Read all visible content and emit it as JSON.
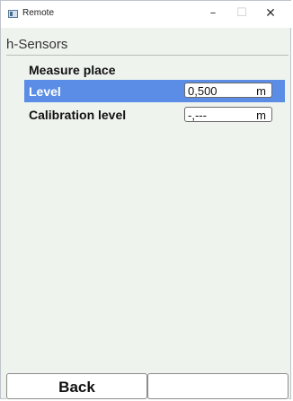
{
  "window": {
    "title": "Remote",
    "icon": "app-icon",
    "controls": {
      "minimize": "–",
      "maximize": "☐",
      "close": "✕"
    }
  },
  "screen": {
    "section_title": "h-Sensors",
    "items": [
      {
        "label": "Measure place"
      },
      {
        "label": "Level",
        "value": "0,500",
        "unit": "m",
        "selected": true
      },
      {
        "label": "Calibration level",
        "value": "-,---",
        "unit": "m"
      }
    ]
  },
  "footer": {
    "left_button": "Back",
    "right_button": ""
  },
  "colors": {
    "selection": "#5b8de6",
    "background": "#eef3ee"
  }
}
